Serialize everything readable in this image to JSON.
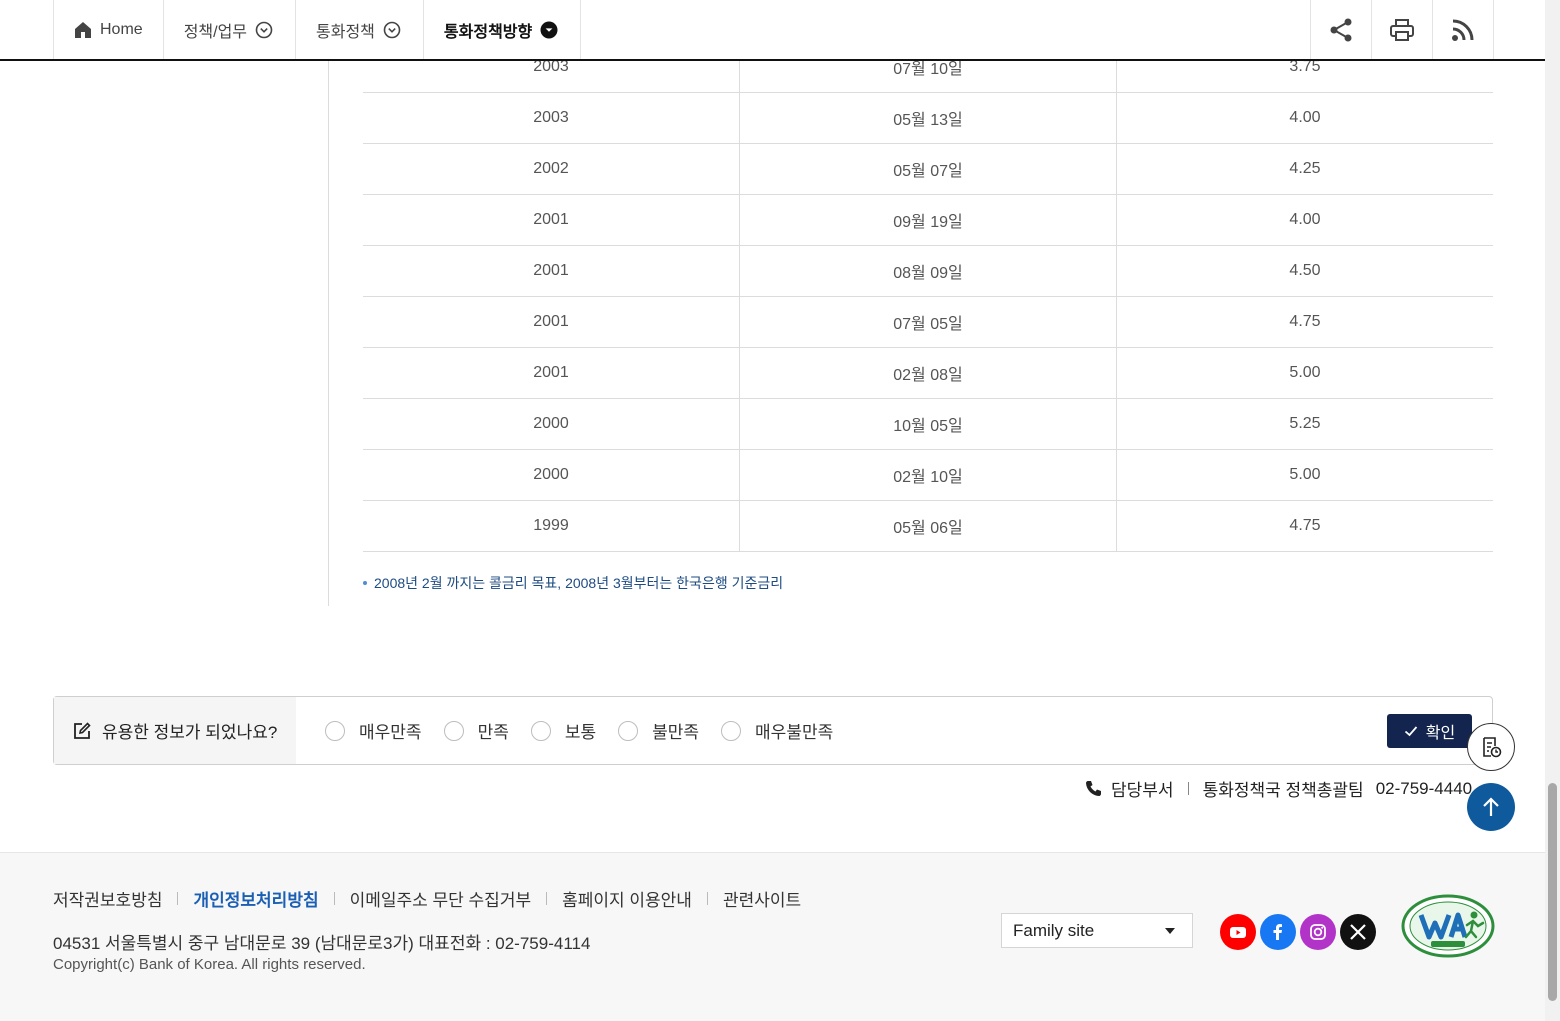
{
  "breadcrumb": {
    "items": [
      {
        "label": "Home"
      },
      {
        "label": "정책/업무"
      },
      {
        "label": "통화정책"
      },
      {
        "label": "통화정책방향"
      }
    ]
  },
  "toolbar": {
    "share_icon": "share-icon",
    "print_icon": "print-icon",
    "rss_icon": "rss-icon"
  },
  "table": {
    "rows": [
      [
        "2003",
        "07월 10일",
        "3.75"
      ],
      [
        "2003",
        "05월 13일",
        "4.00"
      ],
      [
        "2002",
        "05월 07일",
        "4.25"
      ],
      [
        "2001",
        "09월 19일",
        "4.00"
      ],
      [
        "2001",
        "08월 09일",
        "4.50"
      ],
      [
        "2001",
        "07월 05일",
        "4.75"
      ],
      [
        "2001",
        "02월 08일",
        "5.00"
      ],
      [
        "2000",
        "10월 05일",
        "5.25"
      ],
      [
        "2000",
        "02월 10일",
        "5.00"
      ],
      [
        "1999",
        "05월 06일",
        "4.75"
      ]
    ]
  },
  "note": "2008년 2월 까지는 콜금리 목표, 2008년 3월부터는 한국은행 기준금리",
  "survey": {
    "question": "유용한 정보가 되었나요?",
    "options": [
      "매우만족",
      "만족",
      "보통",
      "불만족",
      "매우불만족"
    ],
    "confirm": "확인"
  },
  "dept": {
    "label": "담당부서",
    "team": "통화정책국 정책총괄팀",
    "phone": "02-759-4440"
  },
  "footer": {
    "links": [
      "저작권보호방침",
      "개인정보처리방침",
      "이메일주소 무단 수집거부",
      "홈페이지 이용안내",
      "관련사이트"
    ],
    "address": "04531 서울특별시 중구 남대문로 39 (남대문로3가) 대표전화 : 02-759-4114",
    "copyright": "Copyright(c) Bank of Korea. All rights reserved.",
    "family_site": "Family site",
    "social": [
      "youtube-icon",
      "facebook-icon",
      "instagram-icon",
      "x-icon"
    ],
    "colors": {
      "accent": "#13254e",
      "link": "#1b5fb5",
      "top_button": "#0f5a9c"
    }
  }
}
